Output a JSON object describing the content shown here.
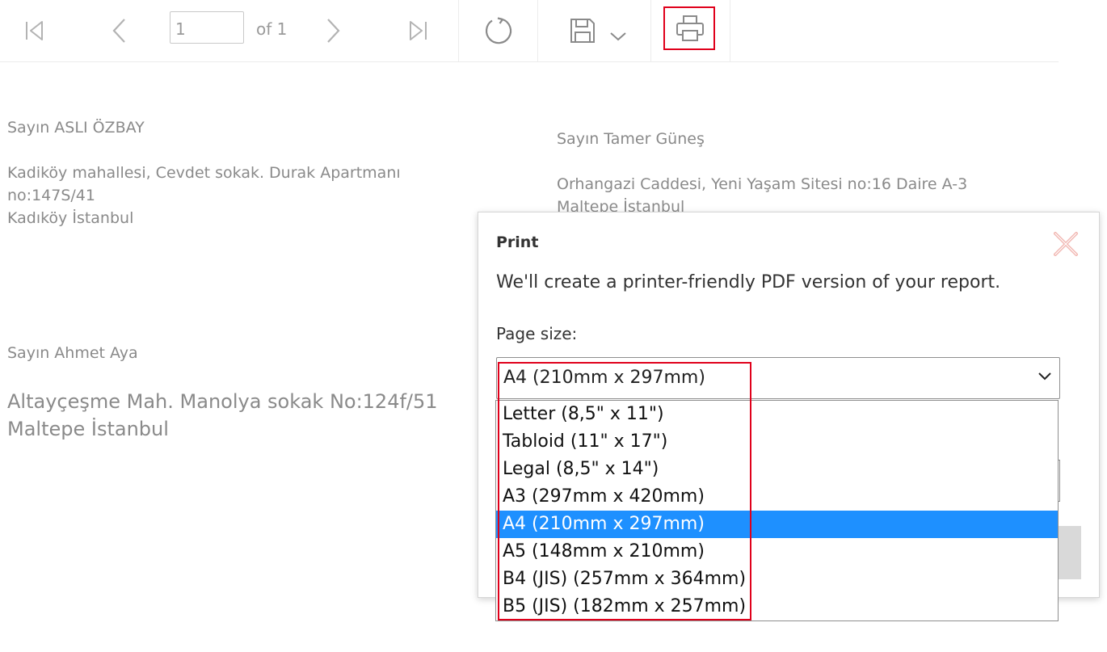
{
  "toolbar": {
    "page_value": "1",
    "page_of": "of 1",
    "icons": [
      "first-page-icon",
      "previous-page-icon",
      "next-page-icon",
      "last-page-icon",
      "refresh-icon",
      "save-icon",
      "chevron-down-icon",
      "print-icon"
    ],
    "highlight_color": "#e0001b"
  },
  "report": {
    "recipient1": {
      "name": "Sayın ASLI ÖZBAY",
      "address1": "Kadiköy mahallesi, Cevdet sokak. Durak Apartmanı",
      "address2": "no:147S/41",
      "city": "Kadıköy İstanbul"
    },
    "recipient2": {
      "name": "Sayın Tamer Güneş",
      "address1": "Orhangazi Caddesi, Yeni Yaşam Sitesi no:16 Daire A-3",
      "city": "Maltepe İstanbul"
    },
    "recipient3": {
      "name": "Sayın Ahmet Aya",
      "address1": "Altayçeşme Mah. Manolya sokak No:124f/51",
      "city": "Maltepe İstanbul"
    },
    "text_color": "#8a8a8a"
  },
  "print_dialog": {
    "title": "Print",
    "description": "We'll create a printer-friendly PDF version of your report.",
    "page_size_label": "Page size:",
    "selected_value": "A4 (210mm x 297mm)",
    "options": [
      "Letter (8,5\" x 11\")",
      "Tabloid (11\" x 17\")",
      "Legal (8,5\" x 14\")",
      "A3 (297mm x 420mm)",
      "A4 (210mm x 297mm)",
      "A5 (148mm x 210mm)",
      "B4 (JIS) (257mm x 364mm)",
      "B5 (JIS) (182mm x 257mm)"
    ],
    "selected_index": 4,
    "selected_color": "#1e90ff",
    "close_icon": "close-icon"
  }
}
